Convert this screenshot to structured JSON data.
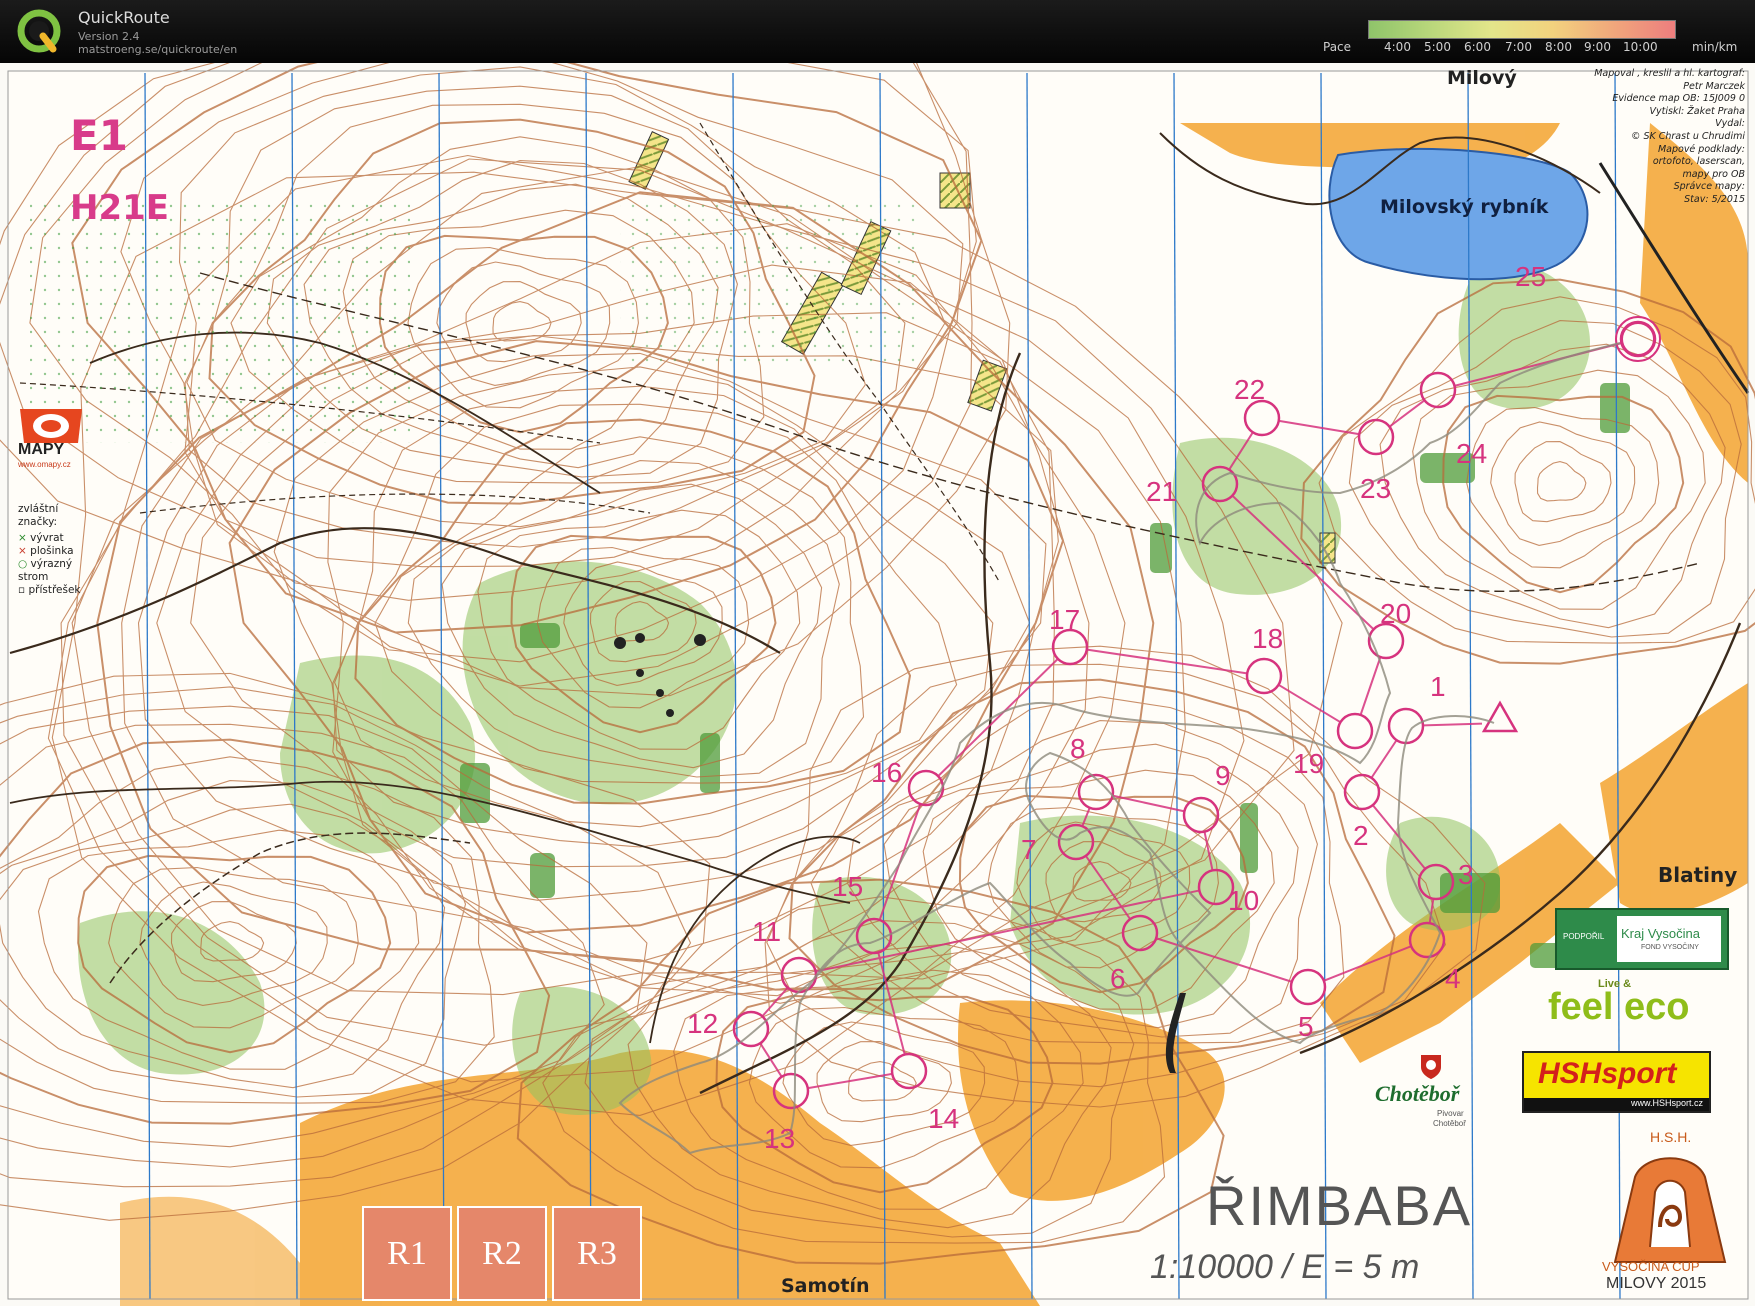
{
  "app": {
    "name": "QuickRoute",
    "version": "Version 2.4",
    "url": "matstroeng.se/quickroute/en",
    "pace_label": "Pace",
    "pace_unit": "min/km",
    "pace_ticks": [
      "4:00",
      "5:00",
      "6:00",
      "7:00",
      "8:00",
      "9:00",
      "10:00"
    ]
  },
  "map": {
    "class_label": "E1",
    "category_label": "H21E",
    "title": "ŘIMBABA",
    "scale_text": "1:10000 / E = 5 m",
    "place_labels": {
      "milovy": "Milový",
      "lake": "Milovský rybník",
      "blatiny": "Blatiny",
      "samotin": "Samotín"
    },
    "credits": [
      "Mapoval , kreslil a hl. kartograf:",
      "Petr Marczek",
      "Evidence map OB: 15J009 0",
      "Vytiskl: Žaket Praha",
      "Vydal:",
      "© SK Chrast u Chrudimi",
      "Mapové podklady:",
      "ortofoto, laserscan,",
      "mapy pro OB",
      "Správce mapy:",
      "Stav: 5/2015"
    ],
    "legend_title": "zvláštní značky:",
    "legend_items": [
      "vývrat",
      "plošinka",
      "výrazný strom",
      "přístřešek"
    ],
    "omapy_text": "MAPY",
    "omapy_url": "www.omapy.cz",
    "sponsor_kraj": {
      "small": "PODPOŘIL",
      "name": "Kraj Vysočina",
      "sub": "FOND VYSOČINY"
    },
    "sponsor_feeleco": {
      "small": "Live &",
      "name": "feel eco"
    },
    "sponsor_hsh": {
      "name": "HSHsport",
      "url": "www.HSHsport.cz"
    },
    "sponsor_chotebor": {
      "name": "Chotěboř",
      "sub1": "Pivovar",
      "sub2": "Chotěboř"
    },
    "cup_logo": {
      "top": "H.S.H.",
      "name": "VYSOČINA CUP",
      "place": "MILOVY 2015"
    },
    "relay_boxes": [
      "R1",
      "R2",
      "R3"
    ],
    "controls": [
      {
        "n": "1"
      },
      {
        "n": "2"
      },
      {
        "n": "3"
      },
      {
        "n": "4"
      },
      {
        "n": "5"
      },
      {
        "n": "6"
      },
      {
        "n": "7"
      },
      {
        "n": "8"
      },
      {
        "n": "9"
      },
      {
        "n": "10"
      },
      {
        "n": "11"
      },
      {
        "n": "12"
      },
      {
        "n": "13"
      },
      {
        "n": "14"
      },
      {
        "n": "15"
      },
      {
        "n": "16"
      },
      {
        "n": "17"
      },
      {
        "n": "18"
      },
      {
        "n": "19"
      },
      {
        "n": "20"
      },
      {
        "n": "21"
      },
      {
        "n": "22"
      },
      {
        "n": "23"
      },
      {
        "n": "24"
      },
      {
        "n": "25"
      }
    ],
    "colors": {
      "course": "#d6337e",
      "contour": "#b86b3a",
      "vegetation_green": "#8fc35f",
      "open_land": "#f4a93b",
      "water": "#6ea6e8",
      "northline": "#2d79c9"
    }
  }
}
